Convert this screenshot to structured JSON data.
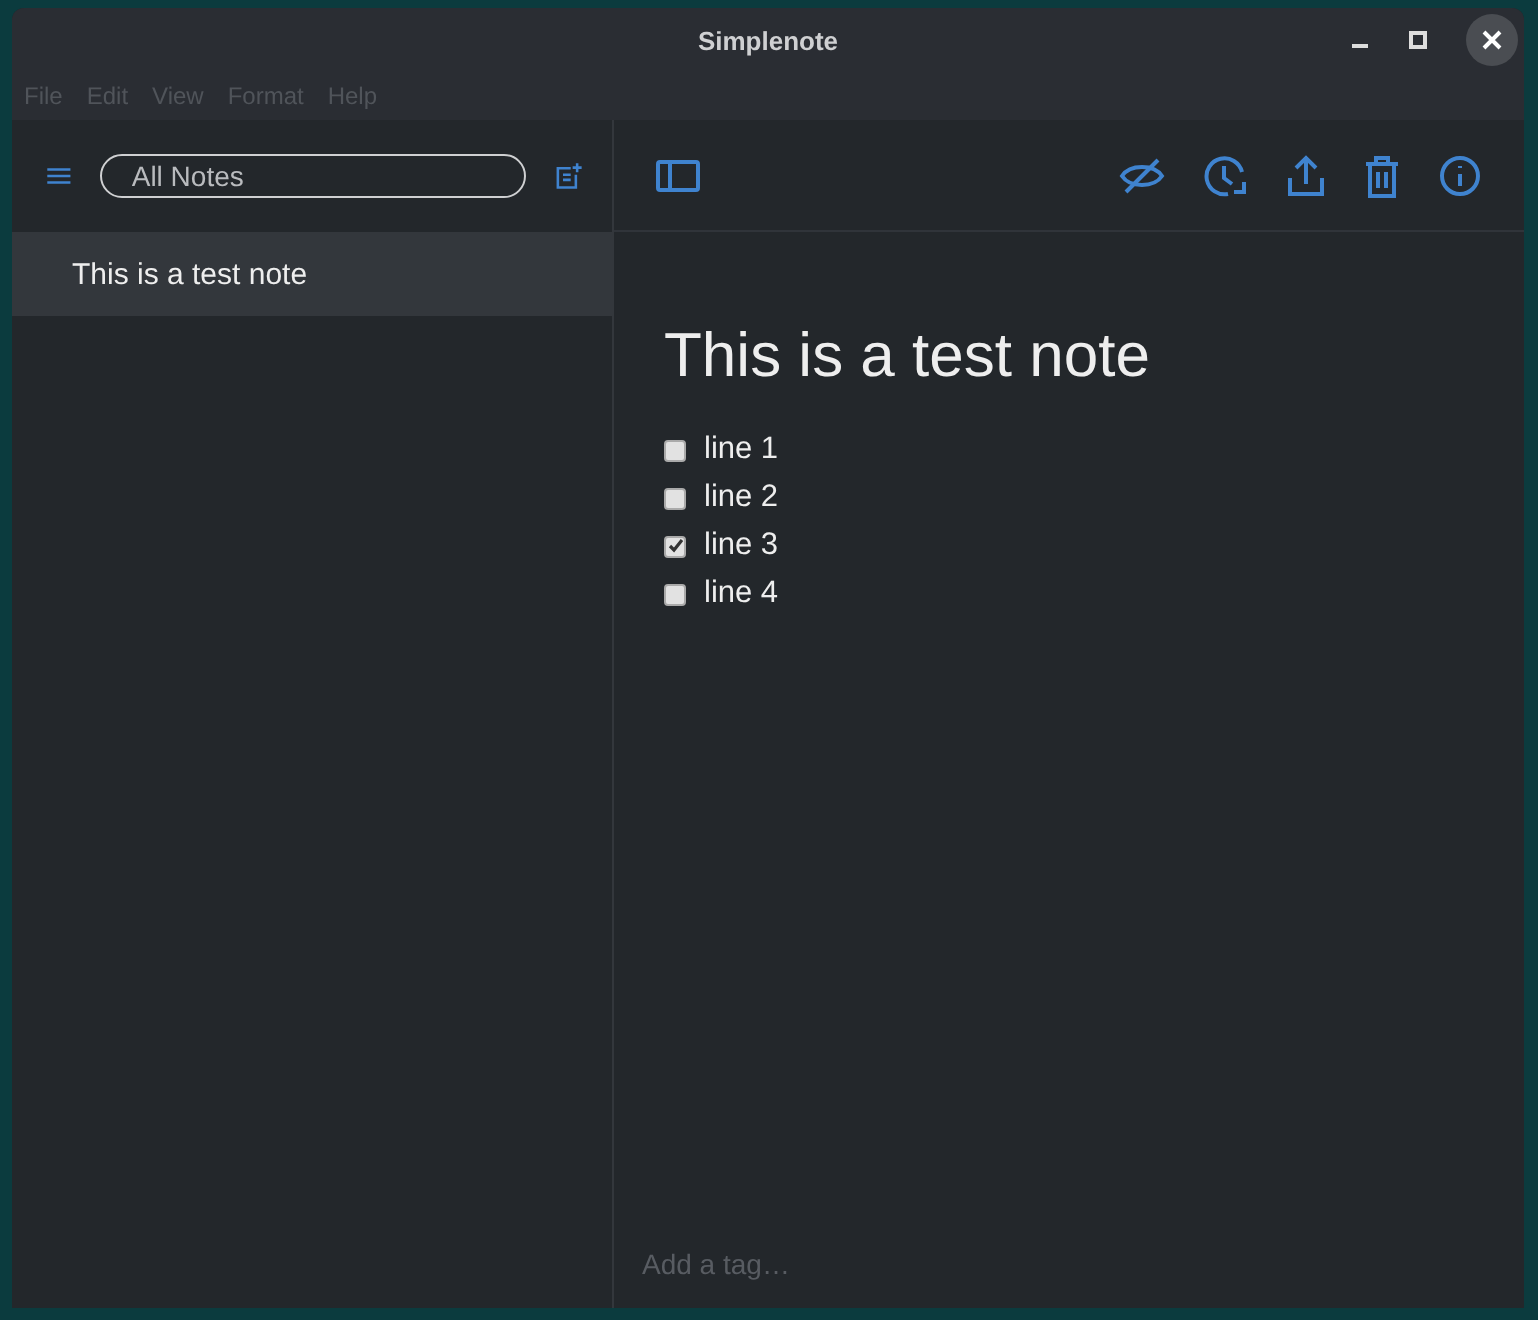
{
  "window": {
    "title": "Simplenote"
  },
  "menu": [
    "File",
    "Edit",
    "View",
    "Format",
    "Help"
  ],
  "sidebar": {
    "search": {
      "value": "All Notes"
    },
    "notes": [
      {
        "title": "This is a test note",
        "selected": true
      }
    ]
  },
  "note": {
    "title": "This is a test note",
    "items": [
      {
        "text": "line 1",
        "checked": false
      },
      {
        "text": "line 2",
        "checked": false
      },
      {
        "text": "line 3",
        "checked": true
      },
      {
        "text": "line 4",
        "checked": false
      }
    ]
  },
  "tags": {
    "placeholder": "Add a tag…"
  }
}
